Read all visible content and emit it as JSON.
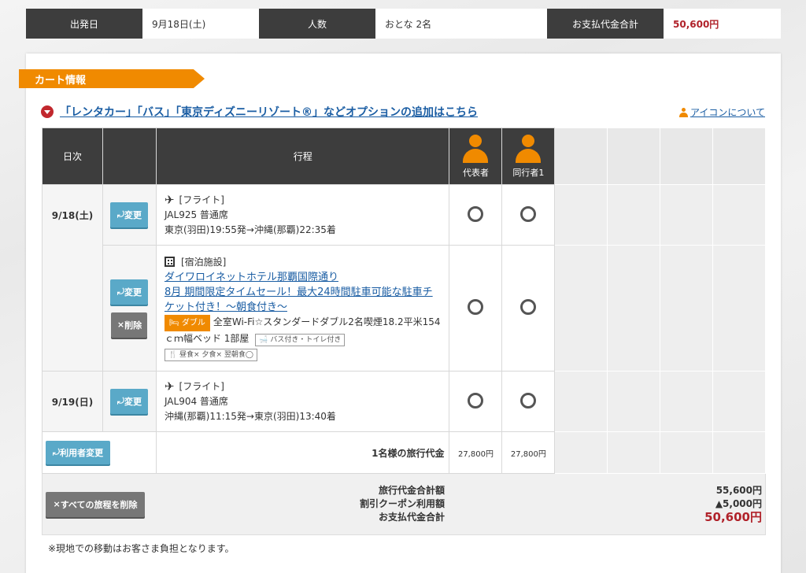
{
  "summary": {
    "depart_label": "出発日",
    "depart_value": "9月18日(土)",
    "people_label": "人数",
    "people_value": "おとな 2名",
    "payment_label": "お支払代金合計",
    "payment_value": "50,600円"
  },
  "cart": {
    "title": "カート情報",
    "option_link": "「レンタカー」「バス」「東京ディズニーリゾート®」などオプションの追加はこちら",
    "icon_about": "アイコンについて"
  },
  "table": {
    "header_date": "日次",
    "header_itinerary": "行程",
    "traveler1": "代表者",
    "traveler2": "同行者1",
    "change_label": "変更",
    "delete_label": "削除",
    "rows": [
      {
        "date": "9/18(土)",
        "type": "[フライト]",
        "line1": "JAL925 普通席",
        "line2": "東京(羽田)19:55発→沖縄(那覇)22:35着"
      },
      {
        "type": "[宿泊施設]",
        "hotel_name": "ダイワロイネットホテル那覇国際通り",
        "plan_name": "8月 期間限定タイムセール！最大24時間駐車可能な駐車チケット付き！～朝食付き～",
        "room_badge": "ダブル",
        "room_desc": "全室Wi-Fi☆スタンダードダブル2名喫煙18.2平米154ｃｍ幅ベッド 1部屋",
        "bath": "バス付き・トイレ付き",
        "meals": "昼食× 夕食× 翌朝食◯"
      },
      {
        "date": "9/19(日)",
        "type": "[フライト]",
        "line1": "JAL904 普通席",
        "line2": "沖縄(那覇)11:15発→東京(羽田)13:40着"
      }
    ],
    "user_change": "利用者変更",
    "fare_label": "1名様の旅行代金",
    "fare1": "27,800円",
    "fare2": "27,800円"
  },
  "totals": {
    "delete_all": "すべての旅程を削除",
    "label_total": "旅行代金合計額",
    "label_coupon": "割引クーポン利用額",
    "label_payment": "お支払代金合計",
    "value_total": "55,600円",
    "value_coupon": "▲5,000円",
    "value_payment": "50,600円"
  },
  "footnote": "※現地での移動はお客さま負担となります。"
}
